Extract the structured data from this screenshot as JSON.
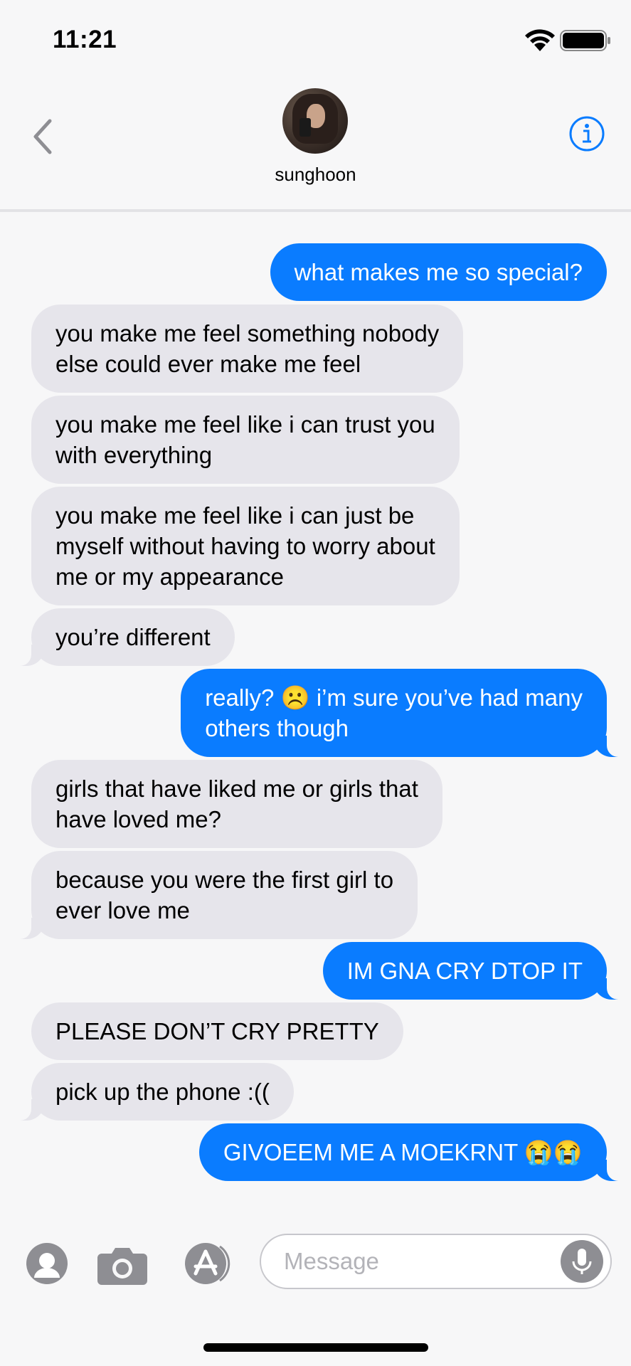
{
  "status_bar": {
    "time": "11:21",
    "wifi_icon": "wifi-icon",
    "battery_icon": "battery-icon"
  },
  "header": {
    "back_icon": "chevron-left-icon",
    "contact_name": "sunghoon",
    "info_icon": "info-icon"
  },
  "colors": {
    "outgoing": "#0a7cff",
    "incoming": "#e6e5eb",
    "background": "#f7f7f8"
  },
  "messages": [
    {
      "dir": "out",
      "text": "what makes me so special?"
    },
    {
      "dir": "in",
      "text": "you make me feel something nobody\nelse could ever make me feel"
    },
    {
      "dir": "in",
      "text": "you make me feel like i can trust you\nwith everything"
    },
    {
      "dir": "in",
      "text": "you make me feel like i can just be\nmyself without having to worry about\nme or my appearance"
    },
    {
      "dir": "in",
      "text": "you’re different"
    },
    {
      "dir": "out",
      "text": "really? ☹️  i’m sure you’ve had many\nothers though"
    },
    {
      "dir": "in",
      "text": "girls that have liked me or girls that\nhave loved me?"
    },
    {
      "dir": "in",
      "text": "because you were the first girl to\never love me"
    },
    {
      "dir": "out",
      "text": "IM GNA CRY DTOP IT"
    },
    {
      "dir": "in",
      "text": "PLEASE DON’T CRY PRETTY"
    },
    {
      "dir": "in",
      "text": "pick up the phone :(("
    },
    {
      "dir": "out",
      "text": "GIVOEEM ME A MOEKRNT 😭😭"
    }
  ],
  "input_bar": {
    "contact_icon": "memoji-icon",
    "camera_icon": "camera-icon",
    "apps_icon": "app-store-icon",
    "placeholder": "Message",
    "mic_icon": "microphone-icon"
  }
}
